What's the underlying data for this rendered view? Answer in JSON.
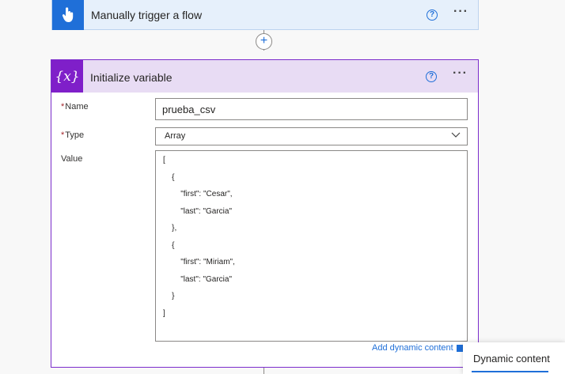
{
  "trigger_card": {
    "title": "Manually trigger a flow",
    "icon": "touch-hand-icon",
    "help": "?",
    "more": "···"
  },
  "connector": {
    "add_label": "+"
  },
  "variable_card": {
    "title": "Initialize variable",
    "icon_text": "{x}",
    "help": "?",
    "more": "···",
    "fields": {
      "name_label": "Name",
      "name_value": "prueba_csv",
      "type_label": "Type",
      "type_value": "Array",
      "value_label": "Value",
      "required_marker": "*"
    },
    "value_lines": [
      "[",
      "    {",
      "        \"first\": \"Cesar\",",
      "        \"last\": \"Garcia\"",
      "    },",
      "    {",
      "        \"first\": \"Miriam\",",
      "        \"last\": \"Garcia\"",
      "    }",
      "]"
    ],
    "add_dynamic_content": "Add dynamic content"
  },
  "dynamic_panel": {
    "tab_label": "Dynamic content"
  },
  "colors": {
    "trigger_accent": "#1f6fd8",
    "variable_accent": "#7f1fc9",
    "link": "#1f6fd8",
    "required": "#a4262c"
  }
}
